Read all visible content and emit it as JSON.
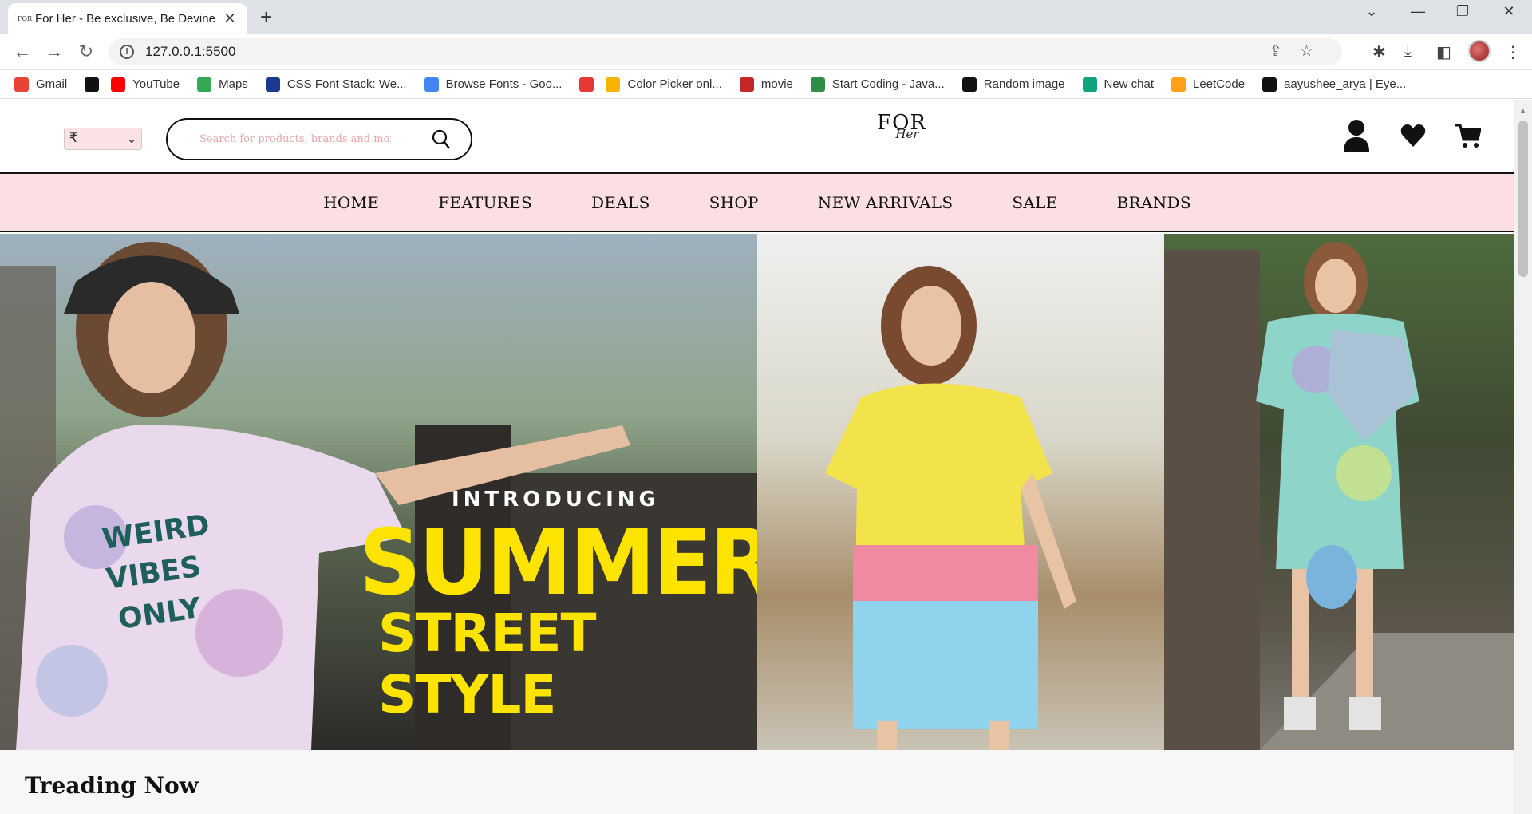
{
  "browser": {
    "tab_title": "For Her - Be exclusive, Be Devine",
    "tab_favicon_text": "FOR",
    "url": "127.0.0.1:5500",
    "bookmarks": [
      {
        "label": "Gmail",
        "icon": "gmail-icon",
        "color": "#ea4335"
      },
      {
        "label": "",
        "icon": "mickey-icon",
        "color": "#111111"
      },
      {
        "label": "YouTube",
        "icon": "youtube-icon",
        "color": "#ff0000"
      },
      {
        "label": "Maps",
        "icon": "maps-icon",
        "color": "#34a853"
      },
      {
        "label": "CSS Font Stack: We...",
        "icon": "cssfont-icon",
        "color": "#1a3a8f"
      },
      {
        "label": "Browse Fonts - Goo...",
        "icon": "googlefonts-icon",
        "color": "#4285f4"
      },
      {
        "label": "",
        "icon": "colorpicker-icon",
        "color": "#e53935"
      },
      {
        "label": "Color Picker onl...",
        "icon": "hand-icon",
        "color": "#f4b400"
      },
      {
        "label": "movie",
        "icon": "movie-icon",
        "color": "#c62828"
      },
      {
        "label": "Start Coding - Java...",
        "icon": "gfg-icon",
        "color": "#2f8d46"
      },
      {
        "label": "Random image",
        "icon": "unsplash-icon",
        "color": "#111111"
      },
      {
        "label": "New chat",
        "icon": "chatgpt-icon",
        "color": "#10a37f"
      },
      {
        "label": "LeetCode",
        "icon": "leetcode-icon",
        "color": "#ffa116"
      },
      {
        "label": "aayushee_arya | Eye...",
        "icon": "e-icon",
        "color": "#111111"
      }
    ]
  },
  "header": {
    "currency": "₹",
    "search_placeholder": "Search for products, brands and more",
    "logo_top": "FOR",
    "logo_bottom": "Her"
  },
  "nav": {
    "items": [
      "HOME",
      "FEATURES",
      "DEALS",
      "SHOP",
      "NEW ARRIVALS",
      "SALE",
      "BRANDS"
    ]
  },
  "hero": {
    "intro": "INTRODUCING",
    "headline": "SUMMER",
    "subheadline": "STREET STYLE",
    "accent_color": "#fce300"
  },
  "sections": {
    "trending_title": "Treading Now"
  },
  "colors": {
    "nav_bg": "#fcdfe2",
    "placeholder": "#e8a7ad"
  }
}
